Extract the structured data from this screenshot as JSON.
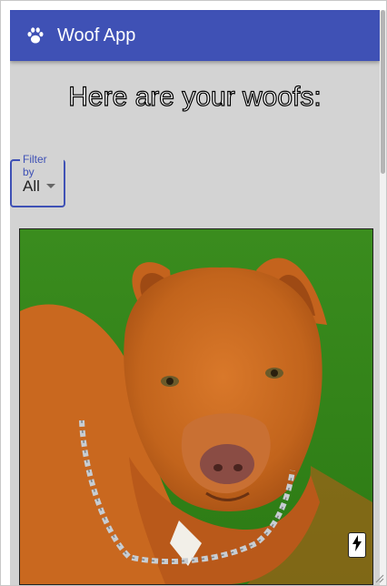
{
  "appbar": {
    "title": "Woof App",
    "icon": "paw-icon",
    "color": "#3f51b5"
  },
  "heading": "Here are your woofs:",
  "filter": {
    "label": "Filter by",
    "selected": "All"
  },
  "card": {
    "image": "dog-photo",
    "action_icon": "lightning-bolt-icon"
  },
  "colors": {
    "page_bg": "#d3d3d3",
    "accent": "#3f51b5"
  }
}
